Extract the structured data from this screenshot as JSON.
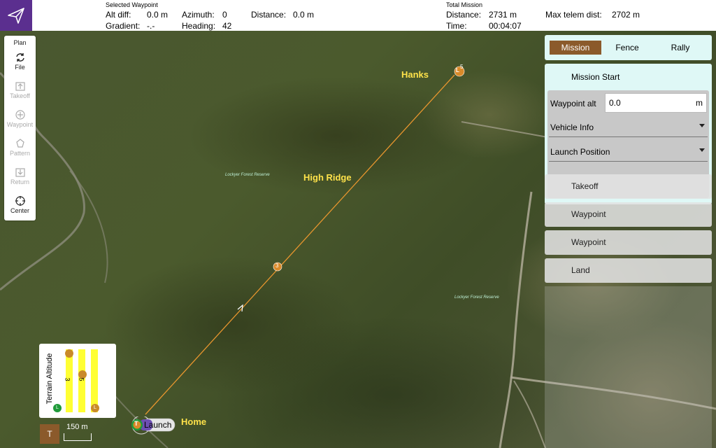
{
  "header": {
    "selected_waypoint_title": "Selected Waypoint",
    "alt_diff_label": "Alt diff:",
    "alt_diff_value": "0.0 m",
    "gradient_label": "Gradient:",
    "gradient_value": "-.-",
    "azimuth_label": "Azimuth:",
    "azimuth_value": "0",
    "heading_label": "Heading:",
    "heading_value": "42",
    "distance_label": "Distance:",
    "distance_value": "0.0 m",
    "total_mission_title": "Total Mission",
    "total_distance_label": "Distance:",
    "total_distance_value": "2731 m",
    "time_label": "Time:",
    "time_value": "00:04:07",
    "max_telem_label": "Max telem dist:",
    "max_telem_value": "2702 m"
  },
  "toolbar": {
    "plan": "Plan",
    "file": "File",
    "takeoff": "Takeoff",
    "waypoint": "Waypoint",
    "pattern": "Pattern",
    "return": "Return",
    "center": "Center"
  },
  "map": {
    "labels": {
      "hanks": "Hanks",
      "high_ridge": "High Ridge",
      "home": "Home",
      "reserve_1": "Lockyer Forest Reserve",
      "reserve_2": "Lockyer Forest Reserve",
      "launch": "Launch"
    },
    "markers": {
      "waypoint_3": "3",
      "waypoint_5": "5",
      "land_marker": "L",
      "takeoff_marker": "T"
    },
    "route_color": "#e8962e"
  },
  "panel": {
    "tabs": [
      "Mission",
      "Fence",
      "Rally"
    ],
    "mission_start": "Mission Start",
    "waypoint_alt_label": "Waypoint alt",
    "waypoint_alt_value": "0.0",
    "waypoint_alt_unit": "m",
    "vehicle_info": "Vehicle Info",
    "launch_position": "Launch Position",
    "items": [
      "Takeoff",
      "Waypoint",
      "Waypoint",
      "Land"
    ]
  },
  "terrain": {
    "title": "Terrain Altitude",
    "marker_3": "3",
    "marker_5": "5",
    "land_left": "L",
    "land_right": "L"
  },
  "scale": {
    "label": "150 m",
    "button": "T"
  },
  "colors": {
    "accent_brown": "#8b5a2b",
    "logo_purple": "#5b2f8f",
    "panel_bg": "#dff8f6",
    "map_label": "#ffe24a"
  }
}
